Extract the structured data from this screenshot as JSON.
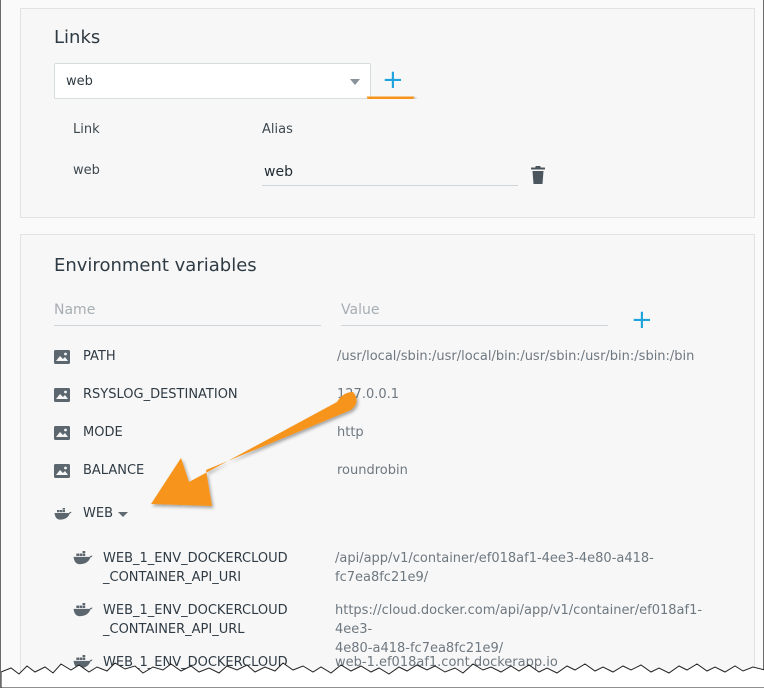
{
  "links": {
    "title": "Links",
    "select_value": "web",
    "add_label": "+",
    "col_link": "Link",
    "col_alias": "Alias",
    "row": {
      "link": "web",
      "alias": "web"
    }
  },
  "env": {
    "title": "Environment variables",
    "name_placeholder": "Name",
    "value_placeholder": "Value",
    "add_label": "+",
    "vars": [
      {
        "name": "PATH",
        "value": "/usr/local/sbin:/usr/local/bin:/usr/sbin:/usr/bin:/sbin:/bin",
        "icon": "image-icon"
      },
      {
        "name": "RSYSLOG_DESTINATION",
        "value": "127.0.0.1",
        "icon": "image-icon"
      },
      {
        "name": "MODE",
        "value": "http",
        "icon": "image-icon"
      },
      {
        "name": "BALANCE",
        "value": "roundrobin",
        "icon": "image-icon"
      }
    ],
    "group": {
      "name": "WEB",
      "icon": "docker-whale-icon"
    },
    "linked": [
      {
        "name_line1": "WEB_1_ENV_DOCKERCLOUD",
        "name_line2": "_CONTAINER_API_URI",
        "value_line1": "/api/app/v1/container/ef018af1-4ee3-4e80-a418-fc7ea8fc21e9/",
        "value_line2": ""
      },
      {
        "name_line1": "WEB_1_ENV_DOCKERCLOUD",
        "name_line2": "_CONTAINER_API_URL",
        "value_line1": "https://cloud.docker.com/api/app/v1/container/ef018af1-4ee3-",
        "value_line2": "4e80-a418-fc7ea8fc21e9/"
      },
      {
        "name_line1": "WEB_1_ENV_DOCKERCLOUD",
        "name_line2": "",
        "value_line1": "web-1.ef018af1.cont.dockerapp.io",
        "value_line2": ""
      }
    ]
  },
  "colors": {
    "accent": "#1ea3dc",
    "annotation_orange": "#f7941d",
    "panel_bg": "#f7f7f7"
  }
}
